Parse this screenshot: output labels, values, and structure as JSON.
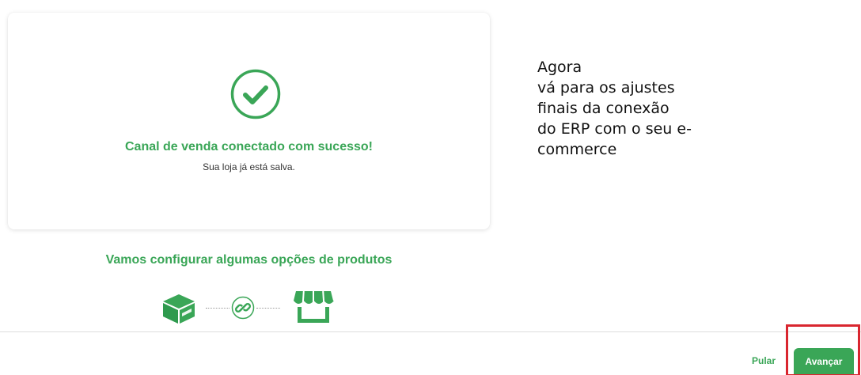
{
  "success_card": {
    "title": "Canal de venda conectado com sucesso!",
    "subtitle": "Sua loja já está salva.",
    "icon": "check-circle-icon",
    "accent_color": "#3aa657"
  },
  "annotation": {
    "text": "Agora\nvá para os ajustes\nfinais da conexão\ndo ERP com o seu e-\ncommerce"
  },
  "configuration": {
    "title": "Vamos configurar algumas opções de produtos",
    "steps": [
      {
        "icon": "box-icon"
      },
      {
        "icon": "link-icon"
      },
      {
        "icon": "store-icon"
      }
    ]
  },
  "footer": {
    "skip_label": "Pular",
    "next_label": "Avançar",
    "button_color": "#3aa657",
    "highlight_color": "#d9262f"
  }
}
